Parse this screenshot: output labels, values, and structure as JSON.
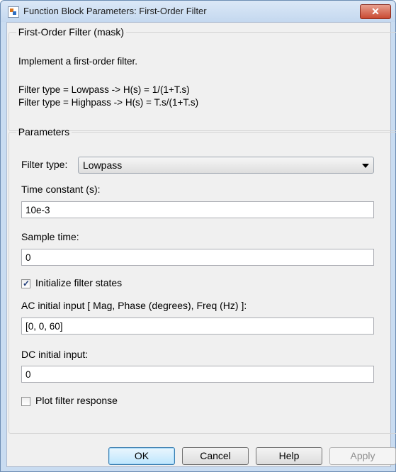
{
  "window": {
    "title": "Function Block Parameters: First-Order Filter",
    "close_label": "✕"
  },
  "description": {
    "group_title": "First-Order Filter (mask)",
    "summary": "Implement a first-order filter.",
    "line1": "Filter type = Lowpass -> H(s) =  1/(1+T.s)",
    "line2": "Filter type = Highpass -> H(s) =  T.s/(1+T.s)"
  },
  "parameters": {
    "group_title": "Parameters",
    "filter_type_label": "Filter type:",
    "filter_type_value": "Lowpass",
    "time_constant_label": "Time constant (s):",
    "time_constant_value": "10e-3",
    "sample_time_label": "Sample time:",
    "sample_time_value": "0",
    "initialize_label": "Initialize filter states",
    "initialize_checked": true,
    "ac_input_label": "AC initial input [ Mag, Phase (degrees), Freq (Hz) ]:",
    "ac_input_value": "[0, 0, 60]",
    "dc_input_label": "DC initial input:",
    "dc_input_value": "0",
    "plot_label": "Plot filter response",
    "plot_checked": false
  },
  "buttons": {
    "ok": "OK",
    "cancel": "Cancel",
    "help": "Help",
    "apply": "Apply"
  }
}
